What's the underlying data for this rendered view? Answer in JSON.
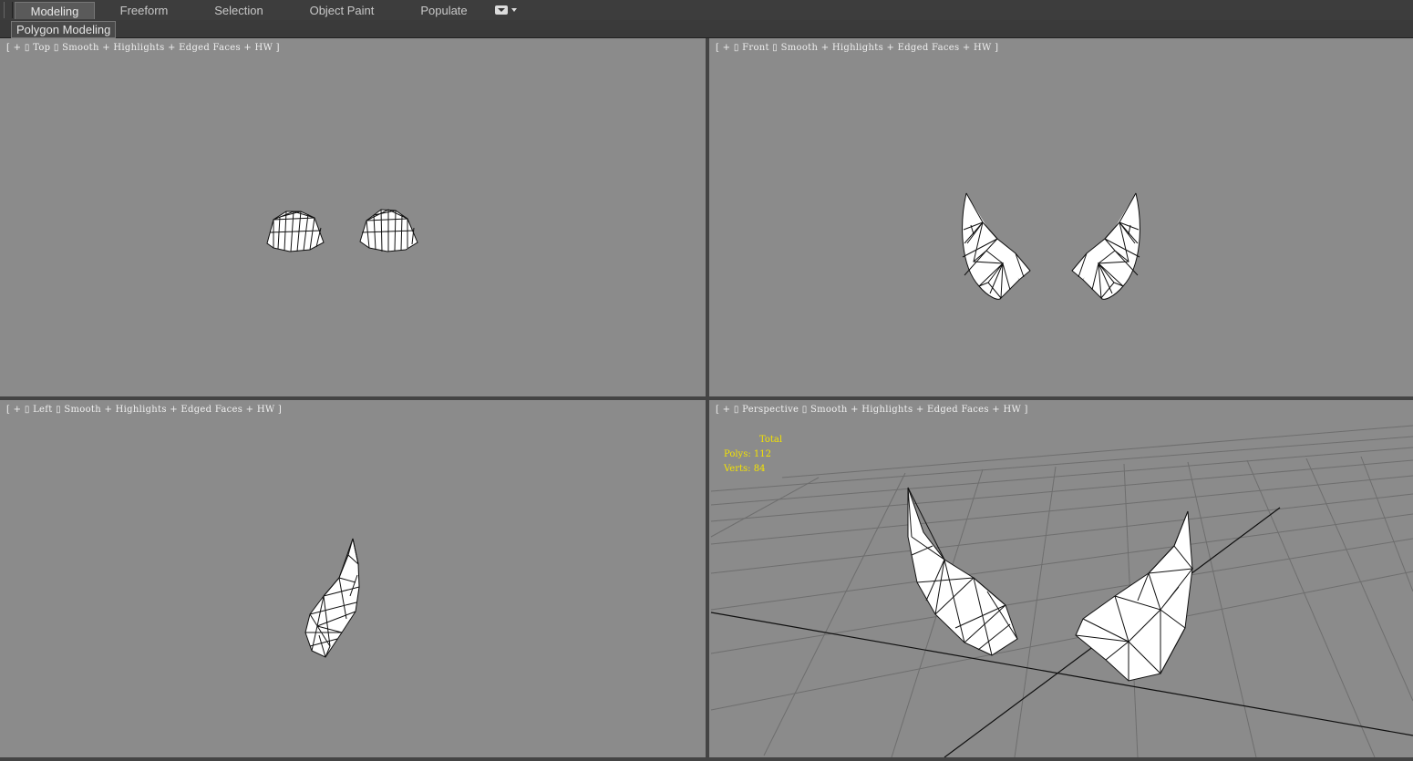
{
  "ribbon": {
    "tabs": [
      "Modeling",
      "Freeform",
      "Selection",
      "Object Paint",
      "Populate"
    ],
    "active_tab": "Modeling",
    "panel_label": "Polygon Modeling",
    "dropdown_icon": "dropdown-arrow-icon"
  },
  "viewports": {
    "top": {
      "label": "[ + ▯ Top ▯ Smooth + Highlights + Edged Faces + HW ]"
    },
    "front": {
      "label": "[ + ▯ Front ▯ Smooth + Highlights + Edged Faces + HW ]"
    },
    "left": {
      "label": "[ + ▯ Left ▯ Smooth + Highlights + Edged Faces + HW ]"
    },
    "perspective": {
      "label": "[ + ▯ Perspective ▯ Smooth + Highlights + Edged Faces + HW ]"
    }
  },
  "stats": {
    "total_label": "Total",
    "polys": "Polys: 112",
    "verts": "Verts: 84"
  },
  "colors": {
    "viewport_bg": "#8b8b8b",
    "stats_text": "#f4e300",
    "ui_bg": "#3d3d3d"
  }
}
